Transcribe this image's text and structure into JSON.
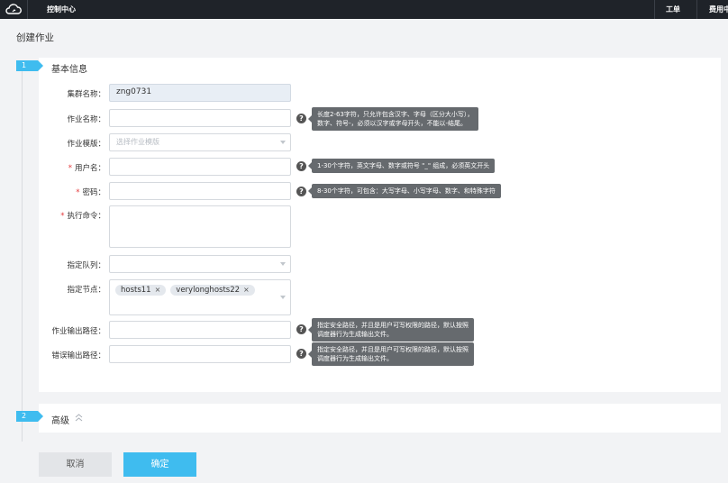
{
  "topbar": {
    "title": "控制中心",
    "ticket_label": "工单",
    "fee_label": "费用中心",
    "logo_icon": "cloud-icon"
  },
  "page_title": "创建作业",
  "steps": [
    {
      "number": "1",
      "title": "基本信息"
    },
    {
      "number": "2",
      "title": "高级"
    }
  ],
  "form": {
    "cluster_name": {
      "label": "集群名称：",
      "value": "zng0731"
    },
    "job_name": {
      "label": "作业名称：",
      "value": "",
      "tip_lines": [
        "长度2-63字符，只允许包含汉字、字母（区分大小写），",
        "数字、符号-，必须以汉字或字母开头，不能以-结尾。"
      ]
    },
    "job_template": {
      "label": "作业模版：",
      "placeholder": "选择作业模版"
    },
    "username": {
      "required": "*",
      "label": "用户名：",
      "value": "",
      "tip_lines": [
        "1-30个字符，英文字母、数字或符号 \"_\" 组成，必须英文开头"
      ]
    },
    "password": {
      "required": "*",
      "label": "密码：",
      "value": "",
      "tip_lines": [
        "8-30个字符，可包含：大写字母、小写字母、数字、和特殊字符"
      ]
    },
    "command": {
      "required": "*",
      "label": "执行命令：",
      "value": ""
    },
    "queue": {
      "label": "指定队列：",
      "value": ""
    },
    "nodes": {
      "label": "指定节点：",
      "tags": [
        "hosts11",
        "verylonghosts22"
      ],
      "remove_glyph": "×"
    },
    "output_path": {
      "label": "作业输出路径：",
      "value": "",
      "tip_lines": [
        "指定安全路径，并且是用户可写权限的路径，默认按照",
        "调度器行为生成输出文件。"
      ]
    },
    "error_path": {
      "label": "错误输出路径：",
      "value": "",
      "tip_lines": [
        "指定安全路径，并且是用户可写权限的路径，默认按照",
        "调度器行为生成输出文件。"
      ]
    }
  },
  "help_glyph": "?",
  "buttons": {
    "cancel": "取消",
    "confirm": "确定"
  },
  "colors": {
    "accent": "#3fbcef",
    "topbar": "#1f2329",
    "required": "#e4393c"
  }
}
